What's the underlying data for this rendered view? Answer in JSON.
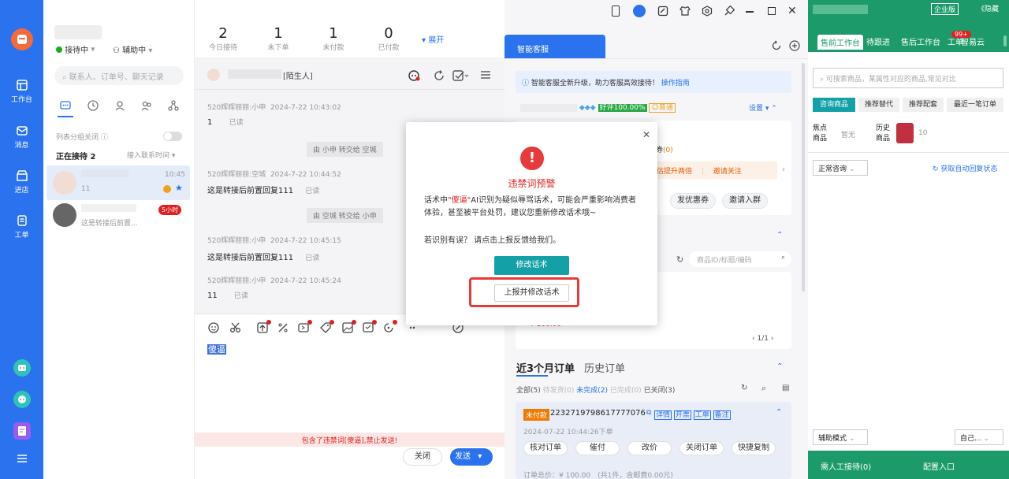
{
  "sidebar": {
    "items": [
      {
        "label": "工作台"
      },
      {
        "label": "消息"
      },
      {
        "label": "进店"
      },
      {
        "label": "工单"
      }
    ]
  },
  "session": {
    "status": "接待中",
    "assist": "辅助中",
    "stats": [
      {
        "value": "2",
        "label": "今日接待"
      },
      {
        "value": "1",
        "label": "未下单"
      },
      {
        "value": "1",
        "label": "未付款"
      },
      {
        "value": "0",
        "label": "已付款"
      }
    ],
    "expand_label": "展开",
    "search_placeholder": "联系人、订单号、聊天记录",
    "group_toggle_label": "列表分组关闭",
    "receiving_label": "正在接待 2",
    "sort_label": "接入联系时间",
    "contacts": [
      {
        "time": "10:45",
        "preview": "11"
      },
      {
        "badge": "5小时",
        "preview": "这是转接后前置..."
      }
    ]
  },
  "chat": {
    "contact_tag": "[陌生人]",
    "messages": [
      {
        "sender": "520辉辉丽丽:小申",
        "time": "2024-7-22 10:43:02",
        "text": "1",
        "status": "已读"
      },
      {
        "system": "由 小申 转交给 空城"
      },
      {
        "sender": "520辉辉丽丽:空城",
        "time": "2024-7-22 10:44:52",
        "text": "这是转接后前置回复111",
        "status": "已读"
      },
      {
        "system": "由 空城 转交给 小申"
      },
      {
        "sender": "520辉辉丽丽:小申",
        "time": "2024-7-22 10:45:15",
        "text": "这是转接后前置回复111",
        "status": "已读"
      },
      {
        "sender": "520辉辉丽丽:小申",
        "time": "2024-7-22 10:45:24",
        "text": "11",
        "status": "已读"
      }
    ],
    "input_text": "傻逼",
    "warning": "包含了违禁词[傻逼],禁止发送!",
    "close_label": "关闭",
    "send_label": "发送"
  },
  "panel": {
    "tab_label": "智能客服",
    "notice": "智能客服全新升级，助力客服高效接待！",
    "notice_link": "操作指南",
    "good_rate": "好评100.00%",
    "level": "普通",
    "settings_label": "设置",
    "coupon_label": "优惠券",
    "coupon_count": "(0)",
    "promo_1": "预估提升两倍",
    "promo_2": "邀请关注",
    "action_1": "发优惠券",
    "action_2": "邀请入群",
    "product_search_placeholder": "商品ID/标题/编码",
    "pager": "1/1",
    "price": "¥ 100.00",
    "orders_tab": "近3个月订单",
    "history_tab": "历史订单",
    "order_filters": [
      {
        "label": "全部",
        "count": "(5)"
      },
      {
        "label": "待发货",
        "count": "(0)"
      },
      {
        "label": "未完成",
        "count": "(2)"
      },
      {
        "label": "已完成",
        "count": "(0)"
      },
      {
        "label": "已关闭",
        "count": "(3)"
      }
    ],
    "order": {
      "badge": "未付款",
      "number": "2232719798617777076",
      "tags": [
        "详情",
        "开票",
        "工单",
        "备注"
      ],
      "date": "2024-07-22 10:44:26下单",
      "actions": [
        "核对订单",
        "催付",
        "改价",
        "关闭订单",
        "快捷复制"
      ],
      "footer": "订单总价：¥ 100.00　(共1件，含邮费0.00元)"
    }
  },
  "farright": {
    "enterprise_label": "企业版",
    "collapse_label": "《隐藏",
    "tabs": [
      "售前工作台",
      "待跟进",
      "售后工作台",
      "工单",
      "智易云"
    ],
    "badge": "99+",
    "search_placeholder": "可搜索商品，某属性对应的商品,常见对比",
    "subtabs": [
      "咨询商品",
      "推荐替代",
      "推荐配套",
      "最近一笔订单"
    ],
    "focus_label": "焦点商品",
    "none_label": "暂无",
    "history_label": "历史商品",
    "history_count": "10",
    "consult_select": "正常咨询",
    "auto_reply": "获取自动回复状态",
    "assist_mode": "辅助模式",
    "self_select": "自己...",
    "manual_label": "需人工接待(0)",
    "config_label": "配置入口"
  },
  "modal": {
    "title": "违禁词预警",
    "body_prefix": "话术中",
    "keyword": "\"傻逼\"",
    "body_suffix": "AI识别为疑似辱骂话术，可能会严重影响消费者体验，甚至被平台处罚，建议您重新修改话术哦~",
    "feedback": "若识别有误？ 请点击上报反馈给我们。",
    "primary_label": "修改话术",
    "secondary_label": "上报并修改话术"
  },
  "colors": {
    "brand_blue": "#2a72ee",
    "teal": "#13a0a6",
    "danger": "#e02020",
    "green": "#1c9a6a"
  }
}
